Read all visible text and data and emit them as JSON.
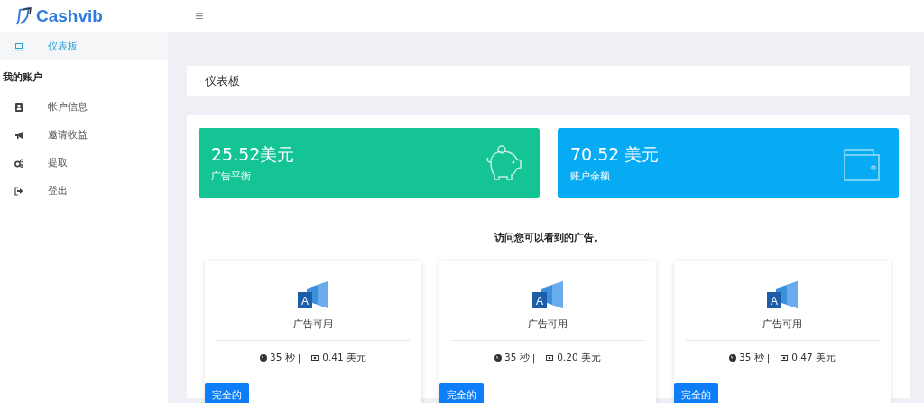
{
  "header": {
    "logo": "Cashvib",
    "menu_glyph": "≡"
  },
  "sidebar": {
    "items": [
      {
        "label": "仪表板",
        "selected": true
      }
    ],
    "section": "我的账户",
    "account_items": [
      {
        "label": "帐户信息",
        "selected": false
      },
      {
        "label": "邀请收益",
        "selected": false
      },
      {
        "label": "提取",
        "selected": false
      },
      {
        "label": "登出",
        "selected": false
      }
    ]
  },
  "page_title": "仪表板",
  "stats": [
    {
      "value": "25.52美元",
      "label": "广告平衡",
      "color": "#14c495"
    },
    {
      "value": "70.52 美元",
      "label": "账户余额",
      "color": "#07abf4"
    }
  ],
  "ads_heading": "访问您可以看到的广告。",
  "ads": [
    {
      "icon_letter": "A",
      "title": "广告可用",
      "time": "35 秒",
      "separator": "|",
      "reward": "0.41 美元",
      "button": "完全的"
    },
    {
      "icon_letter": "A",
      "title": "广告可用",
      "time": "35 秒",
      "separator": "|",
      "reward": "0.20 美元",
      "button": "完全的"
    },
    {
      "icon_letter": "A",
      "title": "广告可用",
      "time": "35 秒",
      "separator": "|",
      "reward": "0.47 美元",
      "button": "完全的"
    }
  ]
}
